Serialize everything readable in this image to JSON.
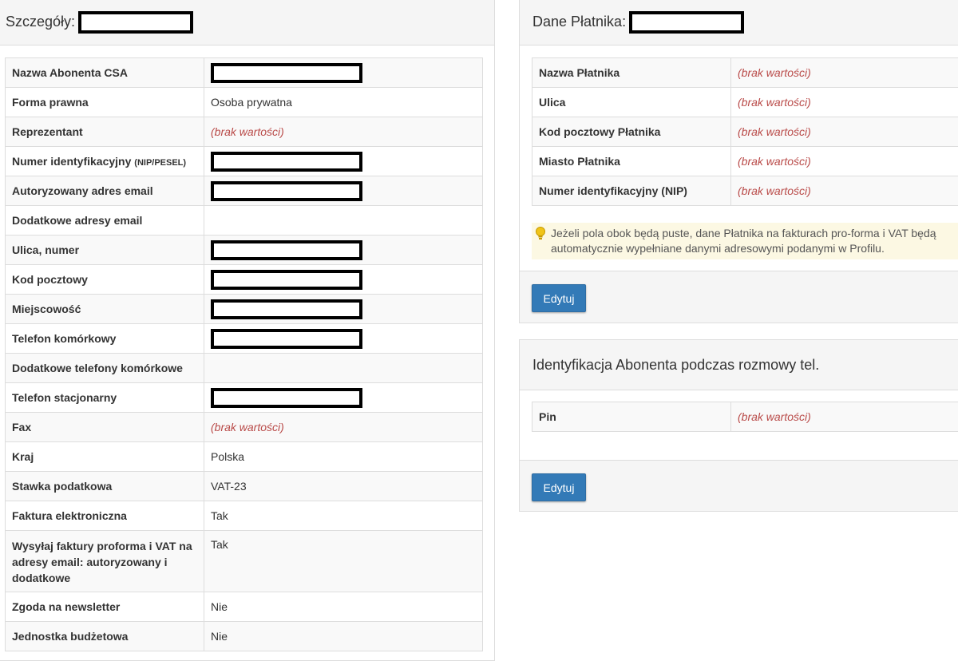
{
  "left_panel": {
    "title": "Szczegóły:",
    "rows": [
      {
        "label": "Nazwa Abonenta CSA",
        "value": null,
        "redacted": true
      },
      {
        "label": "Forma prawna",
        "value": "Osoba prywatna"
      },
      {
        "label": "Reprezentant",
        "value": "(brak wartości)",
        "empty": true
      },
      {
        "label": "Numer identyfikacyjny",
        "label_small": "(NIP/PESEL)",
        "value": null,
        "redacted": true
      },
      {
        "label": "Autoryzowany adres email",
        "value": null,
        "redacted": true
      },
      {
        "label": "Dodatkowe adresy email",
        "value": ""
      },
      {
        "label": "Ulica, numer",
        "value": null,
        "redacted": true
      },
      {
        "label": "Kod pocztowy",
        "value": null,
        "redacted": true
      },
      {
        "label": "Miejscowość",
        "value": null,
        "redacted": true
      },
      {
        "label": "Telefon komórkowy",
        "value": null,
        "redacted": true
      },
      {
        "label": "Dodatkowe telefony komórkowe",
        "value": ""
      },
      {
        "label": "Telefon stacjonarny",
        "value": null,
        "redacted": true
      },
      {
        "label": "Fax",
        "value": "(brak wartości)",
        "empty": true
      },
      {
        "label": "Kraj",
        "value": "Polska"
      },
      {
        "label": "Stawka podatkowa",
        "value": "VAT-23"
      },
      {
        "label": "Faktura elektroniczna",
        "value": "Tak"
      },
      {
        "label": "Wysyłaj faktury proforma i VAT na adresy email: autoryzowany i dodatkowe",
        "value": "Tak"
      },
      {
        "label": "Zgoda na newsletter",
        "value": "Nie"
      },
      {
        "label": "Jednostka budżetowa",
        "value": "Nie"
      }
    ]
  },
  "payer_panel": {
    "title": "Dane Płatnika:",
    "rows": [
      {
        "label": "Nazwa Płatnika",
        "value": "(brak wartości)",
        "empty": true
      },
      {
        "label": "Ulica",
        "value": "(brak wartości)",
        "empty": true
      },
      {
        "label": "Kod pocztowy Płatnika",
        "value": "(brak wartości)",
        "empty": true
      },
      {
        "label": "Miasto Płatnika",
        "value": "(brak wartości)",
        "empty": true
      },
      {
        "label": "Numer identyfikacyjny (NIP)",
        "value": "(brak wartości)",
        "empty": true
      }
    ],
    "notice": "Jeżeli pola obok będą puste, dane Płatnika na fakturach pro-forma i VAT będą automatycznie wypełniane danymi adresowymi podanymi w Profilu.",
    "edit_label": "Edytuj"
  },
  "phone_id_panel": {
    "title": "Identyfikacja Abonenta podczas rozmowy tel.",
    "rows": [
      {
        "label": "Pin",
        "value": "(brak wartości)",
        "empty": true
      }
    ],
    "edit_label": "Edytuj"
  },
  "colors": {
    "empty_value": "#b94a48",
    "button": "#337ab7",
    "notice_bg": "#fcf8e3"
  }
}
